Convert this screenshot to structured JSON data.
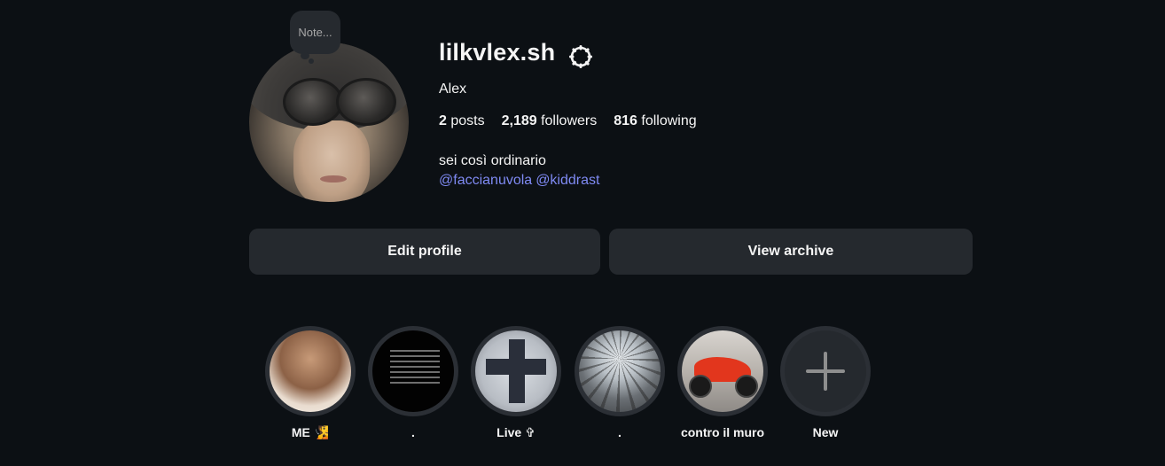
{
  "profile": {
    "username": "lilkvlex.sh",
    "full_name": "Alex",
    "note_placeholder": "Note...",
    "stats": {
      "posts_count": "2",
      "posts_label": " posts",
      "followers_count": "2,189",
      "followers_label": " followers",
      "following_count": "816",
      "following_label": " following"
    },
    "bio": "sei così ordinario",
    "mentions": [
      "@faccianuvola",
      "@kiddrast"
    ]
  },
  "actions": {
    "edit_profile": "Edit profile",
    "view_archive": "View archive"
  },
  "highlights": [
    {
      "label": "ME 🧏"
    },
    {
      "label": "."
    },
    {
      "label": "Live ✞"
    },
    {
      "label": "."
    },
    {
      "label": "contro il muro"
    },
    {
      "label": "New"
    }
  ],
  "icons": {
    "settings": "gear-icon",
    "new_highlight": "plus-icon"
  },
  "colors": {
    "background": "#0c1014",
    "button": "#25292e",
    "link": "#7f8af3",
    "text": "#f5f5f5"
  }
}
